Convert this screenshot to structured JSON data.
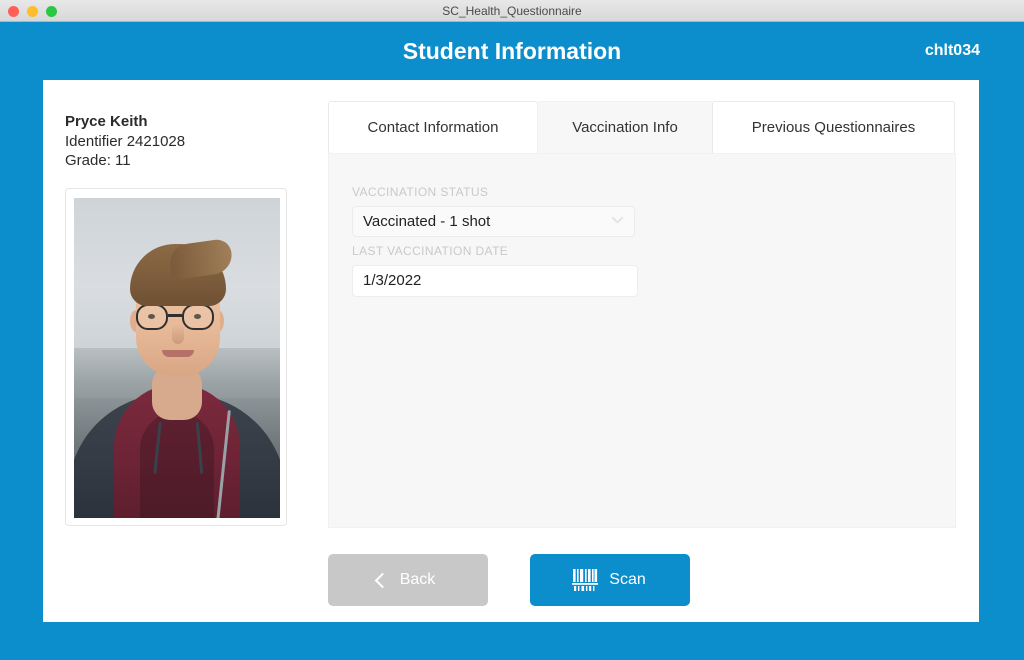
{
  "window": {
    "title": "SC_Health_Questionnaire",
    "traffic_lights": [
      {
        "name": "close",
        "color": "#ff5f57"
      },
      {
        "name": "minimize",
        "color": "#febc2e"
      },
      {
        "name": "zoom",
        "color": "#28c840"
      }
    ]
  },
  "header": {
    "title": "Student Information",
    "code": "chlt034",
    "background_color": "#0b8ecb"
  },
  "student": {
    "name": "Pryce Keith",
    "identifier_line": "Identifier 2421028",
    "grade_line": "Grade: 11",
    "photo_alt": "student-portrait"
  },
  "tabs": [
    {
      "label": "Contact Information",
      "active": false
    },
    {
      "label": "Vaccination Info",
      "active": true
    },
    {
      "label": "Previous Questionnaires",
      "active": false
    }
  ],
  "form": {
    "status_label": "VACCINATION STATUS",
    "status_value": "Vaccinated - 1 shot",
    "date_label": "LAST VACCINATION DATE",
    "date_value": "1/3/2022"
  },
  "footer": {
    "back_label": "Back",
    "back_color": "#c8c8c8",
    "scan_label": "Scan",
    "scan_color": "#0b8ecb"
  }
}
